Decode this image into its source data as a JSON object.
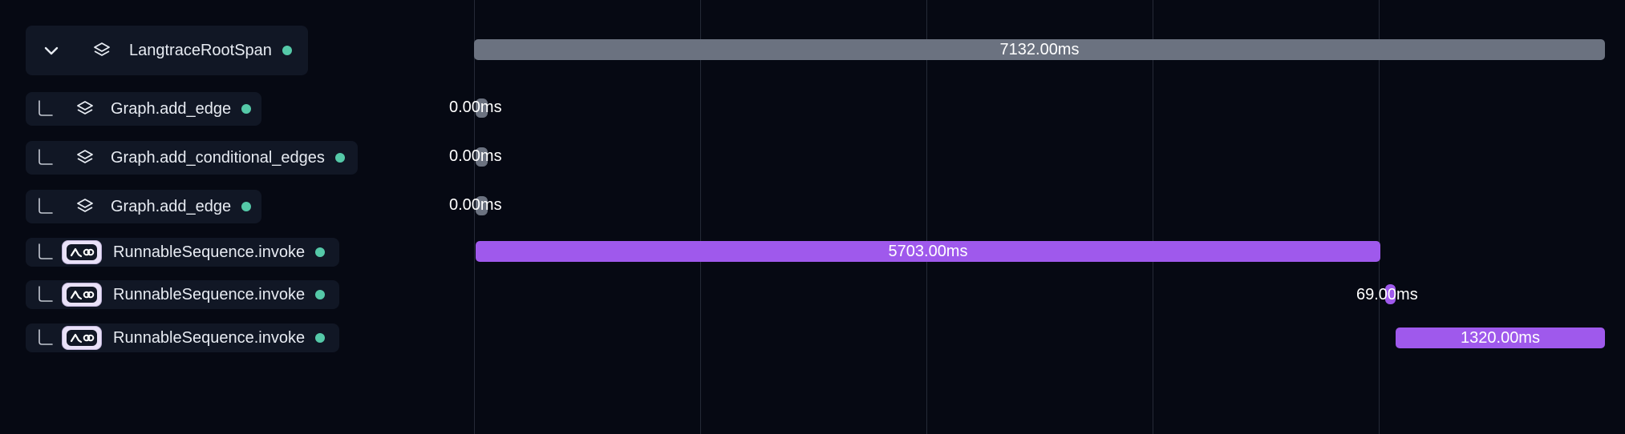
{
  "trace": {
    "spans": [
      {
        "label": "LangtraceRootSpan",
        "duration": "7132.00ms",
        "icon": "layers-icon",
        "status_color": "#55c9a8",
        "bar_color": "#6b7280"
      },
      {
        "label": "Graph.add_edge",
        "duration": "0.00ms",
        "icon": "layers-icon",
        "status_color": "#55c9a8",
        "bar_color": "#6b7280"
      },
      {
        "label": "Graph.add_conditional_edges",
        "duration": "0.00ms",
        "icon": "layers-icon",
        "status_color": "#55c9a8",
        "bar_color": "#6b7280"
      },
      {
        "label": "Graph.add_edge",
        "duration": "0.00ms",
        "icon": "layers-icon",
        "status_color": "#55c9a8",
        "bar_color": "#6b7280"
      },
      {
        "label": "RunnableSequence.invoke",
        "duration": "5703.00ms",
        "icon": "langchain-icon",
        "status_color": "#55c9a8",
        "bar_color": "#9f59ec"
      },
      {
        "label": "RunnableSequence.invoke",
        "duration": "69.00ms",
        "icon": "langchain-icon",
        "status_color": "#55c9a8",
        "bar_color": "#9f59ec"
      },
      {
        "label": "RunnableSequence.invoke",
        "duration": "1320.00ms",
        "icon": "langchain-icon",
        "status_color": "#55c9a8",
        "bar_color": "#9f59ec"
      }
    ]
  }
}
